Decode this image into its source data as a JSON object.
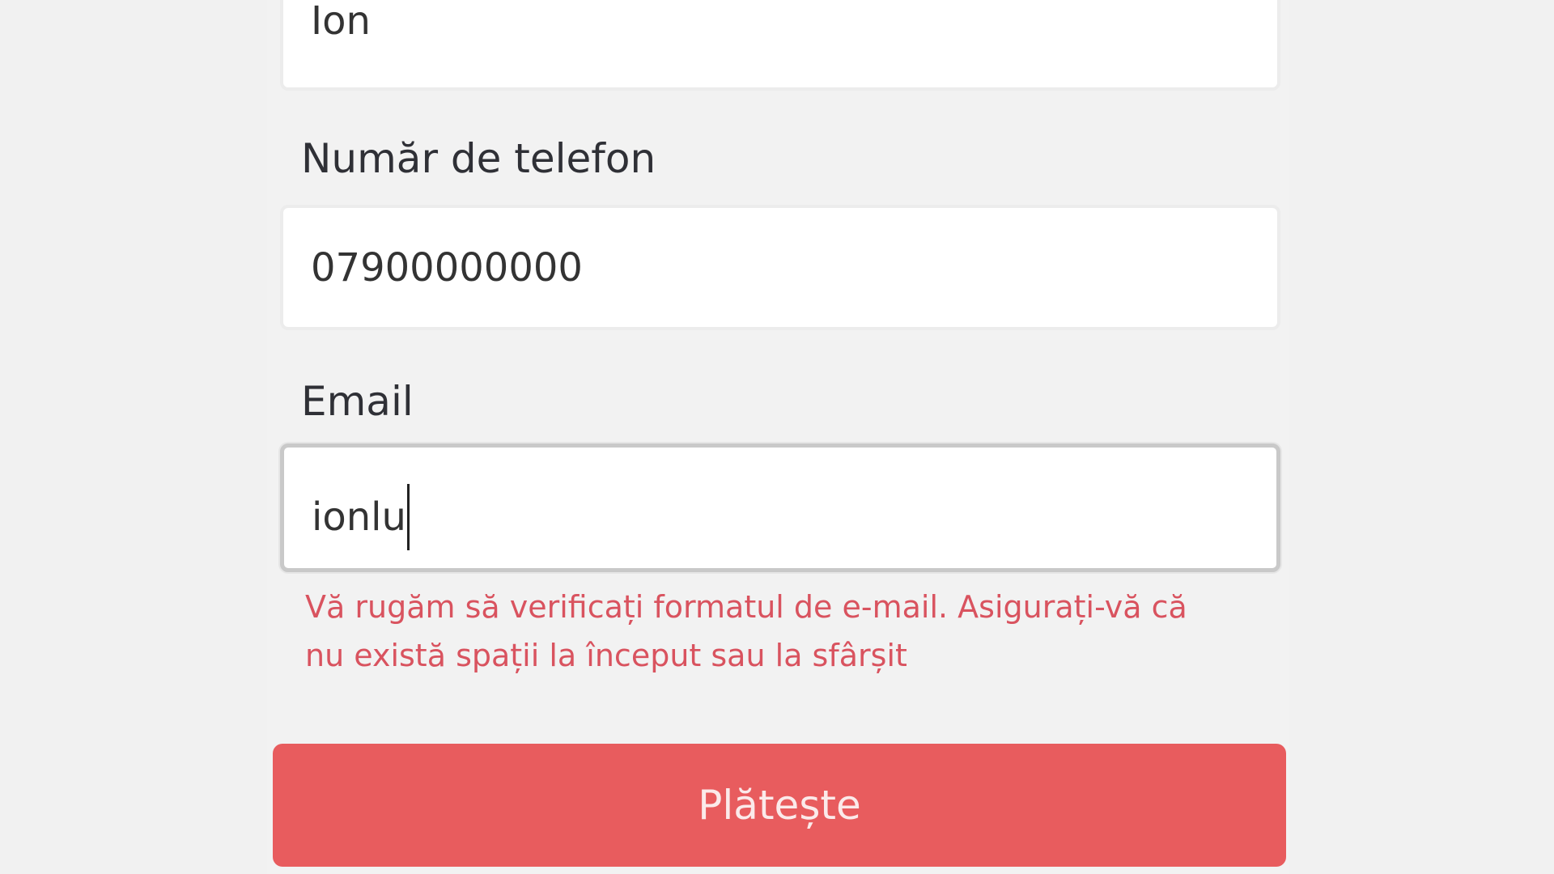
{
  "form": {
    "name": {
      "value": "Ion"
    },
    "phone": {
      "label": "Număr de telefon",
      "value": "07900000000"
    },
    "email": {
      "label": "Email",
      "value": "ionlu",
      "error": "Vă rugăm să verificați formatul de e-mail. Asigurați-vă că nu există spații la început sau la sfârșit"
    },
    "submit_label": "Plătește"
  },
  "colors": {
    "background": "#f1f1f1",
    "field_background": "#ffffff",
    "error_text": "#d9535f",
    "button_background": "#e85c5e",
    "button_text": "#fbeaea"
  }
}
